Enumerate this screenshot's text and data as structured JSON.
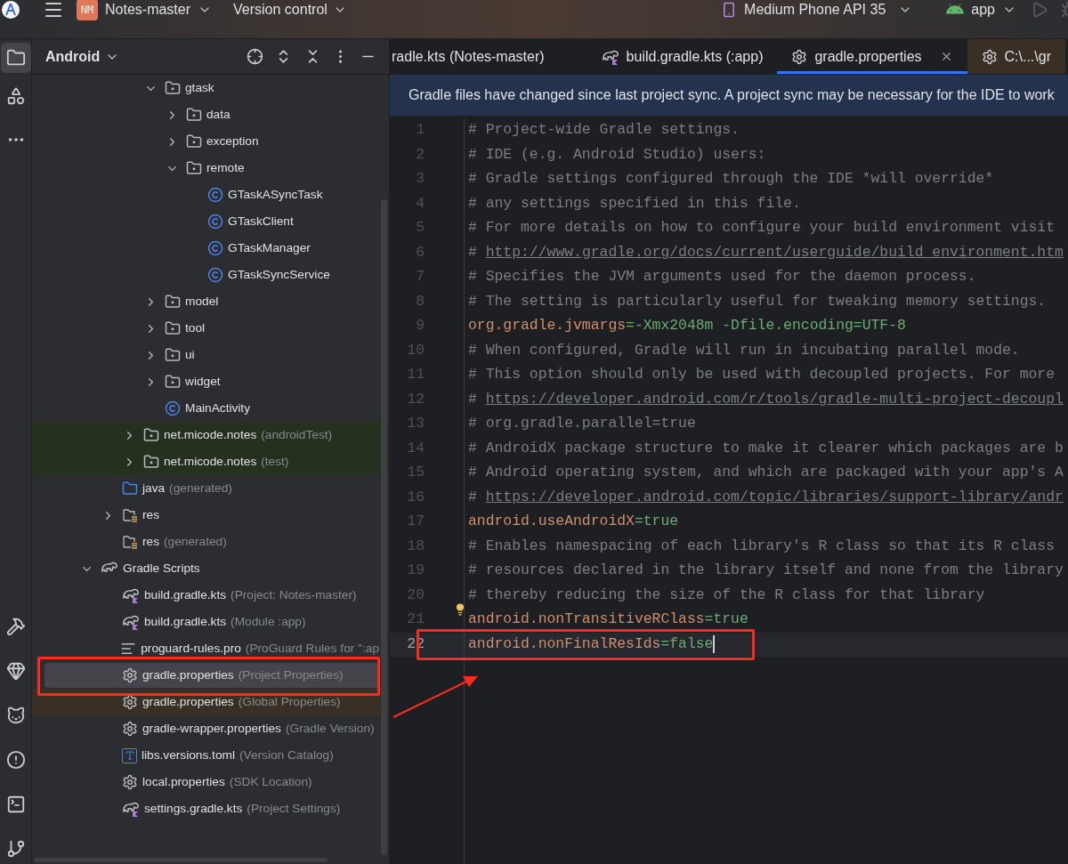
{
  "toolbar": {
    "project_badge": "NM",
    "project": "Notes-master",
    "vcs": "Version control",
    "device": "Medium Phone API 35",
    "run_config": "app"
  },
  "project_panel": {
    "view": "Android",
    "tree": [
      {
        "label": "gtask",
        "kind": "package",
        "expanded": true,
        "selected": false,
        "children": [
          {
            "label": "data",
            "kind": "package",
            "expanded": false,
            "selected": false
          },
          {
            "label": "exception",
            "kind": "package",
            "expanded": false,
            "selected": false
          },
          {
            "label": "remote",
            "kind": "package",
            "expanded": true,
            "selected": false,
            "children": [
              {
                "label": "GTaskASyncTask",
                "kind": "class",
                "selected": false
              },
              {
                "label": "GTaskClient",
                "kind": "class",
                "selected": false
              },
              {
                "label": "GTaskManager",
                "kind": "class",
                "selected": false
              },
              {
                "label": "GTaskSyncService",
                "kind": "class",
                "selected": false
              }
            ]
          }
        ]
      },
      {
        "label": "model",
        "kind": "package",
        "expanded": false,
        "selected": false
      },
      {
        "label": "tool",
        "kind": "package",
        "expanded": false,
        "selected": false
      },
      {
        "label": "ui",
        "kind": "package",
        "expanded": false,
        "selected": false
      },
      {
        "label": "widget",
        "kind": "package",
        "expanded": false,
        "selected": false
      },
      {
        "label": "MainActivity",
        "kind": "class",
        "selected": false
      },
      {
        "label": "net.micode.notes",
        "note": "(androidTest)",
        "kind": "package",
        "expanded": false,
        "selected": false,
        "color": "#26301f"
      },
      {
        "label": "net.micode.notes",
        "note": "(test)",
        "kind": "package",
        "expanded": false,
        "selected": false,
        "color": "#26301f"
      },
      {
        "label": "java",
        "note": "(generated)",
        "kind": "generated",
        "selected": false
      },
      {
        "label": "res",
        "kind": "res",
        "expanded": false,
        "selected": false
      },
      {
        "label": "res",
        "note": "(generated)",
        "kind": "res",
        "selected": false
      },
      {
        "label": "Gradle Scripts",
        "kind": "gradle",
        "expanded": true,
        "selected": false,
        "children": [
          {
            "label": "build.gradle.kts",
            "note": "(Project: Notes-master)",
            "kind": "kts",
            "selected": false
          },
          {
            "label": "build.gradle.kts",
            "note": "(Module :app)",
            "kind": "kts",
            "selected": false
          },
          {
            "label": "proguard-rules.pro",
            "note": "(ProGuard Rules for \":ap",
            "kind": "text",
            "selected": false
          },
          {
            "label": "gradle.properties",
            "note": "(Project Properties)",
            "kind": "settings",
            "selected": true
          },
          {
            "label": "gradle.properties",
            "note": "(Global Properties)",
            "kind": "settings",
            "selected": false,
            "color": "#3a2f24"
          },
          {
            "label": "gradle-wrapper.properties",
            "note": "(Gradle Version)",
            "kind": "settings",
            "selected": false
          },
          {
            "label": "libs.versions.toml",
            "note": "(Version Catalog)",
            "kind": "toml",
            "selected": false
          },
          {
            "label": "local.properties",
            "note": "(SDK Location)",
            "kind": "settings",
            "selected": false
          },
          {
            "label": "settings.gradle.kts",
            "note": "(Project Settings)",
            "kind": "kts",
            "selected": false
          }
        ]
      }
    ]
  },
  "editor": {
    "tabs": [
      {
        "label": "radle.kts (Notes-master)",
        "kind": "plain",
        "selected": false
      },
      {
        "label": "build.gradle.kts (:app)",
        "kind": "kts",
        "selected": false
      },
      {
        "label": "gradle.properties",
        "kind": "settings",
        "selected": true
      },
      {
        "label": "C:\\...\\gr",
        "kind": "settings",
        "selected": false,
        "color": "#3a2f24"
      }
    ],
    "banner": "Gradle files have changed since last project sync. A project sync may be necessary for the IDE to work",
    "lines": [
      {
        "number": "1",
        "kind": "comment",
        "text": "# Project-wide Gradle settings."
      },
      {
        "number": "2",
        "kind": "comment",
        "text": "# IDE (e.g. Android Studio) users:"
      },
      {
        "number": "3",
        "kind": "comment",
        "text": "# Gradle settings configured through the IDE *will override*"
      },
      {
        "number": "4",
        "kind": "comment",
        "text": "# any settings specified in this file."
      },
      {
        "number": "5",
        "kind": "comment",
        "text": "# For more details on how to configure your build environment visit"
      },
      {
        "number": "6",
        "kind": "link",
        "text": "# ",
        "link": "http://www.gradle.org/docs/current/userguide/build_environment.htm"
      },
      {
        "number": "7",
        "kind": "comment",
        "text": "# Specifies the JVM arguments used for the daemon process."
      },
      {
        "number": "8",
        "kind": "comment",
        "text": "# The setting is particularly useful for tweaking memory settings."
      },
      {
        "number": "9",
        "kind": "property",
        "key": "org.gradle.jvmargs",
        "sep": "=",
        "value": "-Xmx2048m -Dfile.encoding=UTF-8"
      },
      {
        "number": "10",
        "kind": "comment",
        "text": "# When configured, Gradle will run in incubating parallel mode."
      },
      {
        "number": "11",
        "kind": "comment",
        "text": "# This option should only be used with decoupled projects. For more"
      },
      {
        "number": "12",
        "kind": "link",
        "text": "# ",
        "link": "https://developer.android.com/r/tools/gradle-multi-project-decoupl"
      },
      {
        "number": "13",
        "kind": "comment",
        "text": "# org.gradle.parallel=true"
      },
      {
        "number": "14",
        "kind": "comment",
        "text": "# AndroidX package structure to make it clearer which packages are b"
      },
      {
        "number": "15",
        "kind": "comment",
        "text": "# Android operating system, and which are packaged with your app's A"
      },
      {
        "number": "16",
        "kind": "link",
        "text": "# ",
        "link": "https://developer.android.com/topic/libraries/support-library/andr"
      },
      {
        "number": "17",
        "kind": "property",
        "key": "android.useAndroidX",
        "sep": "=",
        "value": "true"
      },
      {
        "number": "18",
        "kind": "comment",
        "text": "# Enables namespacing of each library's R class so that its R class"
      },
      {
        "number": "19",
        "kind": "comment",
        "text": "# resources declared in the library itself and none from the library"
      },
      {
        "number": "20",
        "kind": "comment",
        "text": "# thereby reducing the size of the R class for that library"
      },
      {
        "number": "21",
        "kind": "property",
        "key": "android.nonTransitiveRClass",
        "sep": "=",
        "value": "true",
        "bulb": true
      },
      {
        "number": "22",
        "kind": "property",
        "key": "android.nonFinalResIds",
        "sep": "=",
        "value": "false",
        "current": true
      }
    ]
  }
}
